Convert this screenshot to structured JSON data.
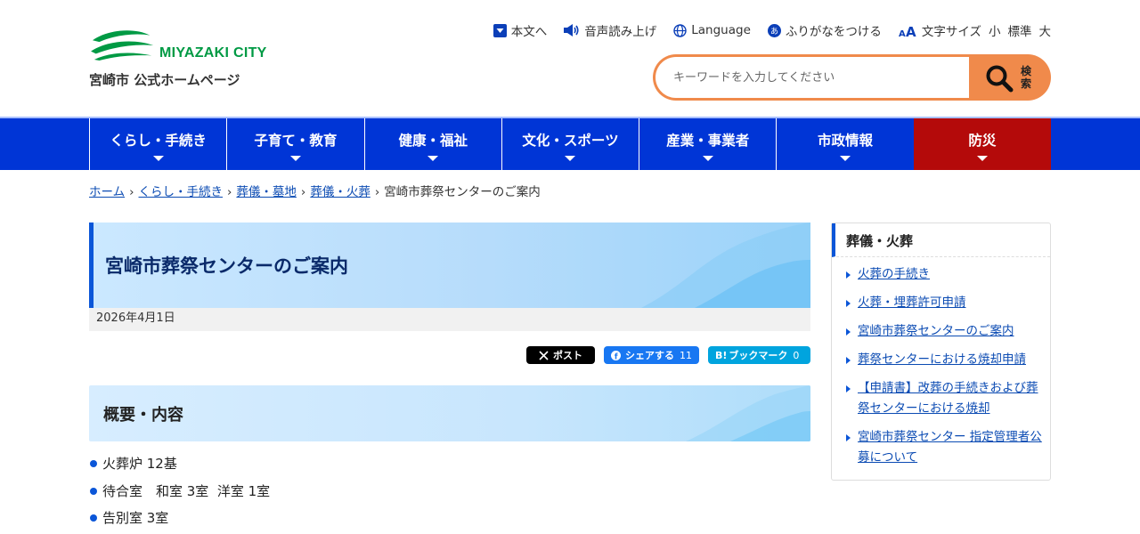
{
  "header": {
    "logo_en": "MIYAZAKI CITY",
    "logo_jp": "宮崎市 公式ホームページ",
    "utility": {
      "skip": "本文へ",
      "read_aloud": "音声読み上げ",
      "language": "Language",
      "furigana": "ふりがなをつける",
      "font_size_label": "文字サイズ",
      "size_small": "小",
      "size_standard": "標準",
      "size_large": "大"
    },
    "search": {
      "placeholder": "キーワードを入力してください",
      "button_label": "検索"
    }
  },
  "nav": {
    "items": [
      {
        "label": "くらし・手続き"
      },
      {
        "label": "子育て・教育"
      },
      {
        "label": "健康・福祉"
      },
      {
        "label": "文化・スポーツ"
      },
      {
        "label": "産業・事業者"
      },
      {
        "label": "市政情報"
      },
      {
        "label": "防災"
      }
    ]
  },
  "breadcrumb": {
    "items": [
      "ホーム",
      "くらし・手続き",
      "葬儀・墓地",
      "葬儀・火葬"
    ],
    "current": "宮崎市葬祭センターのご案内",
    "separator": "›"
  },
  "main": {
    "title": "宮崎市葬祭センターのご案内",
    "date": "2026年4月1日",
    "share": {
      "x_label": "ポスト",
      "fb_label": "シェアする",
      "fb_count": "11",
      "hb_label": "ブックマーク",
      "hb_count": "0"
    },
    "section_title": "概要・内容",
    "facility_items": [
      "火葬炉 12基",
      "待合室　和室 3室  洋室 1室",
      "告別室 3室"
    ]
  },
  "sidebar": {
    "title": "葬儀・火葬",
    "links": [
      "火葬の手続き",
      "火葬・埋葬許可申請",
      "宮崎市葬祭センターのご案内",
      "葬祭センターにおける焼却申請",
      "【申請書】改葬の手続きおよび葬祭センターにおける焼却",
      "宮崎市葬祭センター 指定管理者公募について"
    ]
  },
  "colors": {
    "nav_blue": "#0035d6",
    "bosai_red": "#b40a0a",
    "search_orange": "#f08a4b",
    "logo_green": "#009a44",
    "accent_blue": "#0b56d8"
  }
}
